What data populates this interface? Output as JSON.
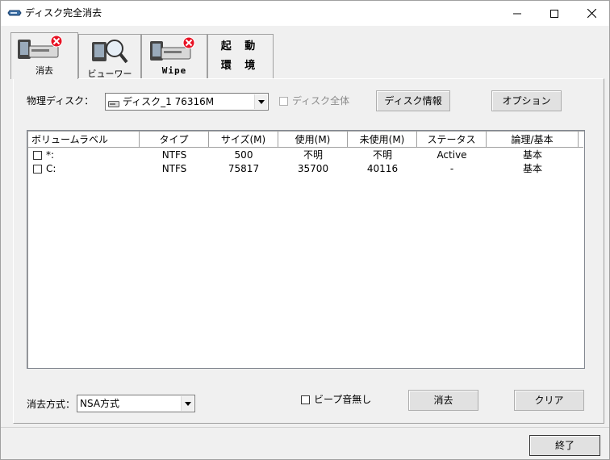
{
  "window": {
    "title": "ディスク完全消去",
    "minimize_label": "minimize",
    "maximize_label": "maximize",
    "close_label": "close"
  },
  "tabs": [
    {
      "label": "消去",
      "icon": "disk-erase-icon",
      "selected": true
    },
    {
      "label": "ビューワー",
      "icon": "disk-viewer-icon",
      "selected": false
    },
    {
      "label": "Wipe",
      "icon": "disk-wipe-icon",
      "selected": false
    },
    {
      "line1": "起 動",
      "line2": "環 境",
      "selected": false
    }
  ],
  "physical_disk": {
    "label": "物理ディスク：",
    "selected": "ディスク_1  76316M",
    "whole_disk_label": "ディスク全体",
    "whole_disk_checked": false,
    "whole_disk_enabled": false
  },
  "buttons": {
    "disk_info": "ディスク情報",
    "options": "オプション",
    "erase": "消去",
    "clear": "クリア",
    "exit": "終了"
  },
  "volume_list": {
    "columns": [
      "ボリュームラベル",
      "タイプ",
      "サイズ(M)",
      "使用(M)",
      "未使用(M)",
      "ステータス",
      "論理/基本"
    ],
    "rows": [
      {
        "label": "*:",
        "type": "NTFS",
        "size": "500",
        "used": "不明",
        "unused": "不明",
        "status": "Active",
        "kind": "基本",
        "checked": false
      },
      {
        "label": "C:",
        "type": "NTFS",
        "size": "75817",
        "used": "35700",
        "unused": "40116",
        "status": "-",
        "kind": "基本",
        "checked": false
      }
    ]
  },
  "erase_method": {
    "label": "消去方式：",
    "selected": "NSA方式"
  },
  "beep": {
    "label": "ビープ音無し",
    "checked": false
  },
  "colors": {
    "window_bg": "#f0f0f0",
    "accent_red": "#e81123",
    "border": "#a0a0a0"
  }
}
